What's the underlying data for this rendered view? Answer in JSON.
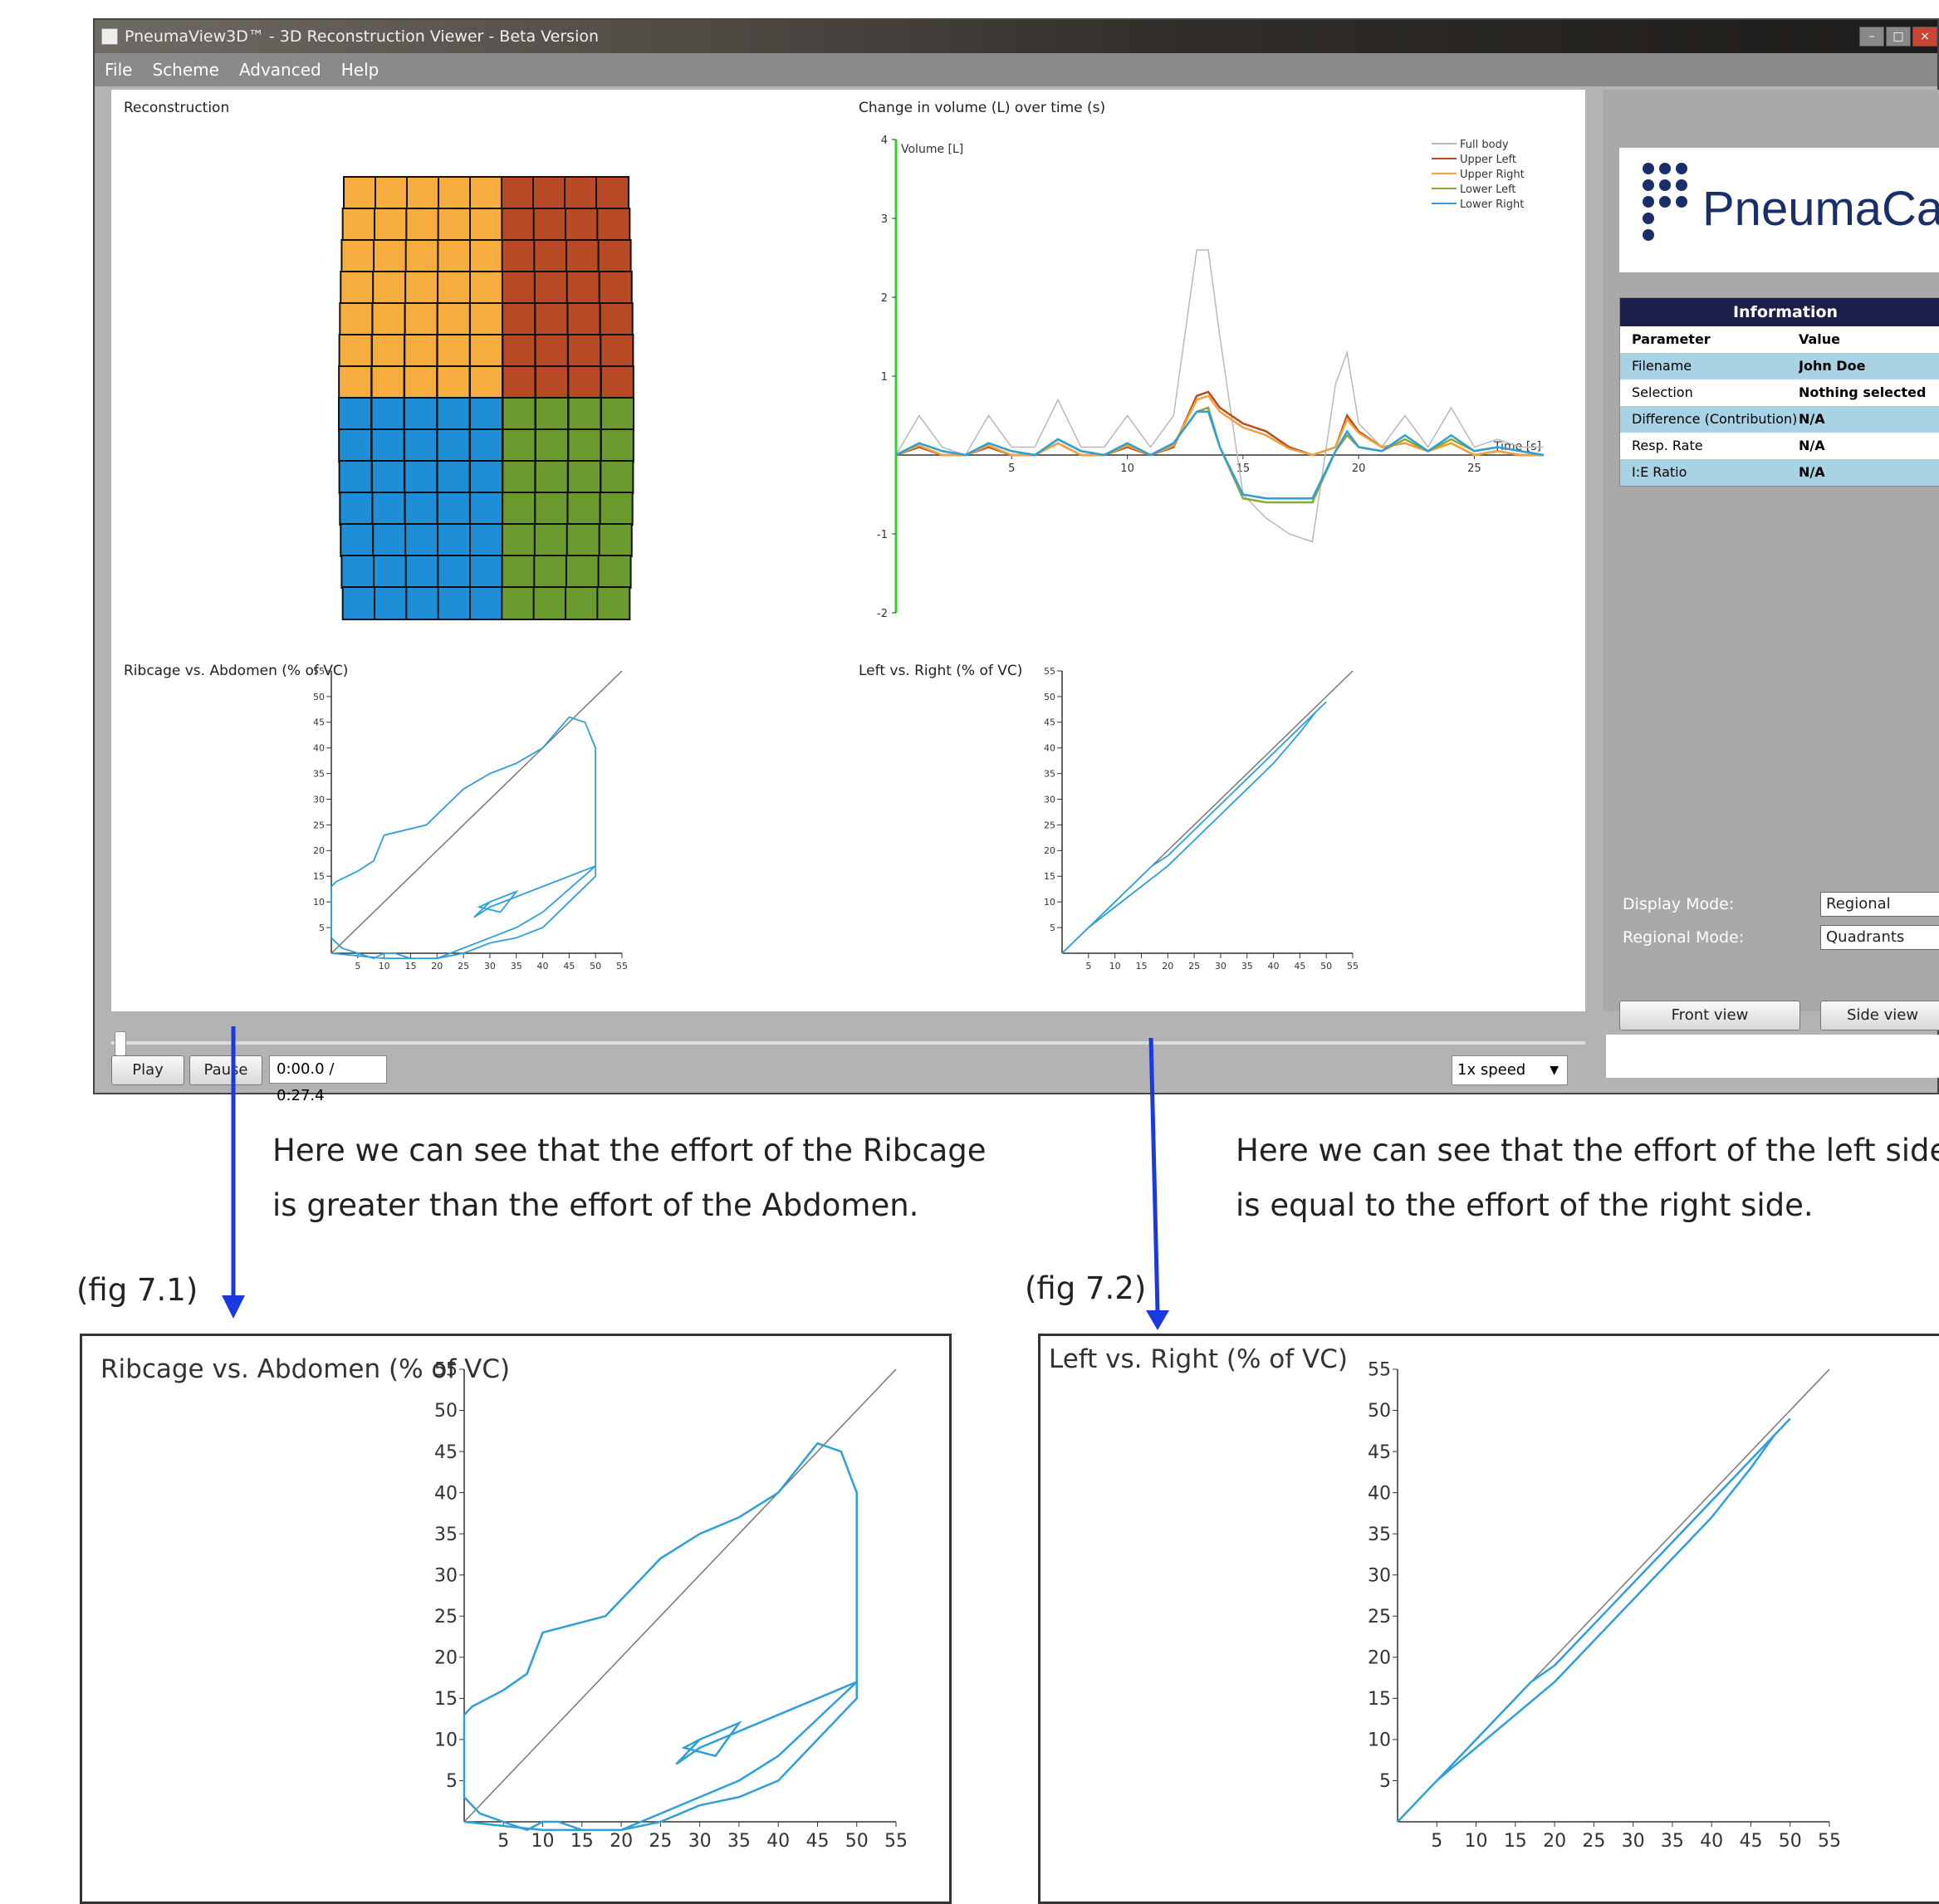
{
  "app": {
    "title": "PneumaView3D™ - 3D Reconstruction Viewer - Beta Version",
    "menu": [
      "File",
      "Scheme",
      "Advanced",
      "Help"
    ],
    "window_buttons": [
      "–",
      "□",
      "×"
    ]
  },
  "reconstruction": {
    "title": "Reconstruction",
    "quadrant_colors": {
      "upper_left": "#f7ad3d",
      "upper_right": "#b84a26",
      "lower_left": "#1e8ed6",
      "lower_right": "#6b9a2e"
    }
  },
  "volume_chart": {
    "title": "Change in volume (L) over time (s)",
    "ylabel": "Volume [L]",
    "xlabel": "Time [s]",
    "legend": [
      "Full body",
      "Upper Left",
      "Upper Right",
      "Lower Left",
      "Lower Right"
    ],
    "series_colors": [
      "#b8b8b8",
      "#b84a1c",
      "#f2a23c",
      "#8da833",
      "#2e9fd8"
    ]
  },
  "rib_abd_title": "Ribcage vs. Abdomen (% of VC)",
  "left_right_title": "Left vs. Right (% of VC)",
  "sidebar": {
    "logo_text": "PneumaCar",
    "info_header": "Information",
    "info_columns": [
      "Parameter",
      "Value"
    ],
    "info_rows": [
      {
        "param": "Filename",
        "value": "John Doe"
      },
      {
        "param": "Selection",
        "value": "Nothing selected"
      },
      {
        "param": "Difference (Contribution)",
        "value": "N/A"
      },
      {
        "param": "Resp. Rate",
        "value": "N/A"
      },
      {
        "param": "I:E Ratio",
        "value": "N/A"
      }
    ],
    "display_mode_label": "Display Mode:",
    "display_mode_value": "Regional",
    "regional_mode_label": "Regional Mode:",
    "regional_mode_value": "Quadrants",
    "front_view": "Front view",
    "side_view": "Side view"
  },
  "playback": {
    "play": "Play",
    "pause": "Pause",
    "time": "0:00.0 / 0:27.4",
    "speed": "1x speed",
    "progress": 0.0
  },
  "annotations": {
    "left_line1": "Here we can see that the effort of the Ribcage",
    "left_line2": "is greater than the effort of the Abdomen.",
    "right_line1": "Here we can see that the effort of the left side",
    "right_line2": "is equal to the effort of the right side.",
    "fig1": "(fig 7.1)",
    "fig2": "(fig 7.2)"
  },
  "chart_data": [
    {
      "type": "line",
      "title": "Change in volume (L) over time (s)",
      "xlabel": "Time [s]",
      "ylabel": "Volume [L]",
      "xlim": [
        0,
        28
      ],
      "ylim": [
        -2,
        4
      ],
      "xticks": [
        5,
        10,
        15,
        20,
        25
      ],
      "yticks": [
        -2,
        -1,
        1,
        2,
        3,
        4
      ],
      "legend_position": "top-right",
      "series": [
        {
          "name": "Full body",
          "x": [
            0,
            1,
            2,
            3,
            4,
            5,
            6,
            7,
            8,
            9,
            10,
            11,
            12,
            13,
            13.5,
            14,
            15,
            16,
            17,
            18,
            19,
            19.5,
            20,
            21,
            22,
            23,
            24,
            25,
            26,
            27,
            28
          ],
          "y": [
            0,
            0.5,
            0.1,
            0,
            0.5,
            0.1,
            0.1,
            0.7,
            0.1,
            0.1,
            0.5,
            0.1,
            0.5,
            2.6,
            2.6,
            1.5,
            -0.5,
            -0.8,
            -1.0,
            -1.1,
            0.9,
            1.3,
            0.4,
            0.1,
            0.5,
            0.1,
            0.6,
            0.1,
            0.2,
            0.1,
            0.1
          ]
        },
        {
          "name": "Upper Left",
          "x": [
            0,
            1,
            2,
            3,
            4,
            5,
            6,
            7,
            8,
            9,
            10,
            11,
            12,
            13,
            13.5,
            14,
            15,
            16,
            17,
            18,
            19,
            19.5,
            20,
            21,
            22,
            23,
            24,
            25,
            26,
            27,
            28
          ],
          "y": [
            0,
            0.1,
            0,
            0,
            0.1,
            0,
            0,
            0.15,
            0,
            0,
            0.1,
            0,
            0.1,
            0.75,
            0.8,
            0.6,
            0.4,
            0.3,
            0.1,
            0,
            0.1,
            0.5,
            0.3,
            0.1,
            0.15,
            0.05,
            0.15,
            0,
            0.05,
            0,
            0
          ]
        },
        {
          "name": "Upper Right",
          "x": [
            0,
            1,
            2,
            3,
            4,
            5,
            6,
            7,
            8,
            9,
            10,
            11,
            12,
            13,
            13.5,
            14,
            15,
            16,
            17,
            18,
            19,
            19.5,
            20,
            21,
            22,
            23,
            24,
            25,
            26,
            27,
            28
          ],
          "y": [
            0,
            0.12,
            0,
            0,
            0.12,
            0,
            0,
            0.15,
            0,
            0,
            0.12,
            0,
            0.12,
            0.7,
            0.75,
            0.55,
            0.35,
            0.25,
            0.08,
            0,
            0.1,
            0.45,
            0.28,
            0.1,
            0.15,
            0.05,
            0.15,
            0,
            0.05,
            0,
            0
          ]
        },
        {
          "name": "Lower Left",
          "x": [
            0,
            1,
            2,
            3,
            4,
            5,
            6,
            7,
            8,
            9,
            10,
            11,
            12,
            13,
            13.5,
            14,
            15,
            16,
            17,
            18,
            19,
            19.5,
            20,
            21,
            22,
            23,
            24,
            25,
            26,
            27,
            28
          ],
          "y": [
            0,
            0.15,
            0.05,
            0,
            0.15,
            0.05,
            0,
            0.2,
            0.05,
            0,
            0.15,
            0,
            0.15,
            0.55,
            0.6,
            0.1,
            -0.55,
            -0.6,
            -0.6,
            -0.6,
            0.05,
            0.25,
            0.1,
            0.05,
            0.2,
            0.05,
            0.2,
            0.05,
            0.1,
            0.05,
            0
          ]
        },
        {
          "name": "Lower Right",
          "x": [
            0,
            1,
            2,
            3,
            4,
            5,
            6,
            7,
            8,
            9,
            10,
            11,
            12,
            13,
            13.5,
            14,
            15,
            16,
            17,
            18,
            19,
            19.5,
            20,
            21,
            22,
            23,
            24,
            25,
            26,
            27,
            28
          ],
          "y": [
            0,
            0.15,
            0.05,
            0,
            0.15,
            0.05,
            0,
            0.2,
            0.05,
            0,
            0.15,
            0,
            0.15,
            0.55,
            0.55,
            0.1,
            -0.5,
            -0.55,
            -0.55,
            -0.55,
            0.05,
            0.3,
            0.1,
            0.05,
            0.25,
            0.05,
            0.25,
            0.05,
            0.1,
            0.05,
            0
          ]
        }
      ]
    },
    {
      "type": "line",
      "title": "Ribcage vs. Abdomen (% of VC)",
      "xlim": [
        0,
        55
      ],
      "ylim": [
        0,
        55
      ],
      "ticks": [
        5,
        10,
        15,
        20,
        25,
        30,
        35,
        40,
        45,
        50,
        55
      ],
      "reference_line": [
        [
          0,
          0
        ],
        [
          55,
          55
        ]
      ],
      "series": [
        {
          "x": [
            0,
            10,
            20,
            25,
            30,
            35,
            40,
            45,
            50,
            50,
            48,
            45,
            40,
            35,
            30,
            25,
            18,
            10,
            8,
            5,
            3,
            1,
            0,
            0,
            2,
            5,
            8,
            10,
            12,
            15,
            20,
            25,
            30,
            35,
            40,
            50,
            40,
            30,
            27,
            30,
            35,
            32,
            28,
            30
          ],
          "y": [
            0,
            -1,
            -1,
            0,
            2,
            3,
            5,
            10,
            15,
            40,
            45,
            46,
            40,
            37,
            35,
            32,
            25,
            23,
            18,
            16,
            15,
            14,
            13,
            3,
            1,
            0,
            -1,
            0,
            0,
            -1,
            -1,
            1,
            3,
            5,
            8,
            17,
            13,
            9,
            7,
            10,
            12,
            8,
            9,
            10
          ]
        }
      ]
    },
    {
      "type": "line",
      "title": "Left vs. Right (% of VC)",
      "xlim": [
        0,
        55
      ],
      "ylim": [
        0,
        55
      ],
      "ticks": [
        5,
        10,
        15,
        20,
        25,
        30,
        35,
        40,
        45,
        50,
        55
      ],
      "reference_line": [
        [
          0,
          0
        ],
        [
          55,
          55
        ]
      ],
      "series": [
        {
          "x": [
            0,
            5,
            10,
            15,
            17,
            20,
            25,
            30,
            35,
            40,
            45,
            50,
            48,
            45,
            40,
            35,
            30,
            25,
            20,
            15,
            10,
            5,
            2,
            0
          ],
          "y": [
            0,
            5,
            10,
            15,
            17,
            19,
            24,
            29,
            34,
            39,
            44,
            49,
            47,
            43,
            37,
            32,
            27,
            22,
            17,
            13,
            9,
            5,
            2,
            0
          ]
        }
      ]
    }
  ]
}
